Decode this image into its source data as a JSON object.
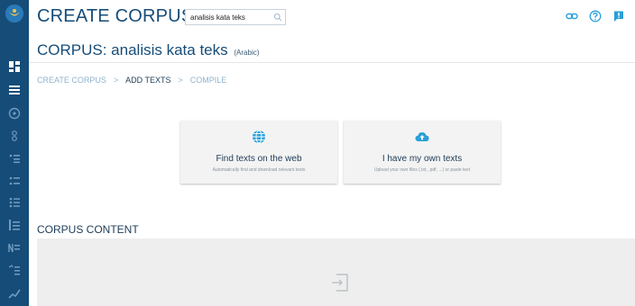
{
  "app": {
    "title": "CREATE CORPUS"
  },
  "search": {
    "value": "analisis kata teks",
    "icon": "search-icon"
  },
  "topbar_icons": [
    "link-icon",
    "help-icon",
    "feedback-icon"
  ],
  "sidebar": {
    "logo": "logo-icon",
    "items": [
      {
        "icon": "dashboard-icon"
      },
      {
        "icon": "corpus-list-icon"
      },
      {
        "icon": "concordance-icon"
      },
      {
        "icon": "word-sketch-icon"
      },
      {
        "icon": "thesaurus-icon"
      },
      {
        "icon": "sketch-diff-icon"
      },
      {
        "icon": "word-list-icon"
      },
      {
        "icon": "ngrams-icon"
      },
      {
        "icon": "keywords-icon"
      },
      {
        "icon": "parallel-icon"
      },
      {
        "icon": "trends-icon"
      }
    ]
  },
  "corpus": {
    "prefix": "CORPUS: analisis kata teks",
    "language": "(Arabic)"
  },
  "breadcrumb": {
    "steps": [
      "CREATE CORPUS",
      "ADD TEXTS",
      "COMPILE"
    ],
    "separator": ">"
  },
  "cards": [
    {
      "icon": "globe-icon",
      "title": "Find texts on the web",
      "subtitle": "Automatically find and download relevant texts"
    },
    {
      "icon": "cloud-upload-icon",
      "title": "I have my own texts",
      "subtitle": "Upload your own files (.txt, .pdf, ...) or paste text"
    }
  ],
  "content": {
    "title": "CORPUS CONTENT",
    "empty_icon": "empty-content-icon"
  },
  "colors": {
    "sidebar": "#164c78",
    "accent": "#2a9fd8",
    "title": "#164c78",
    "breadcrumb_inactive": "#8fb3cf",
    "panel": "#eeeeee"
  }
}
